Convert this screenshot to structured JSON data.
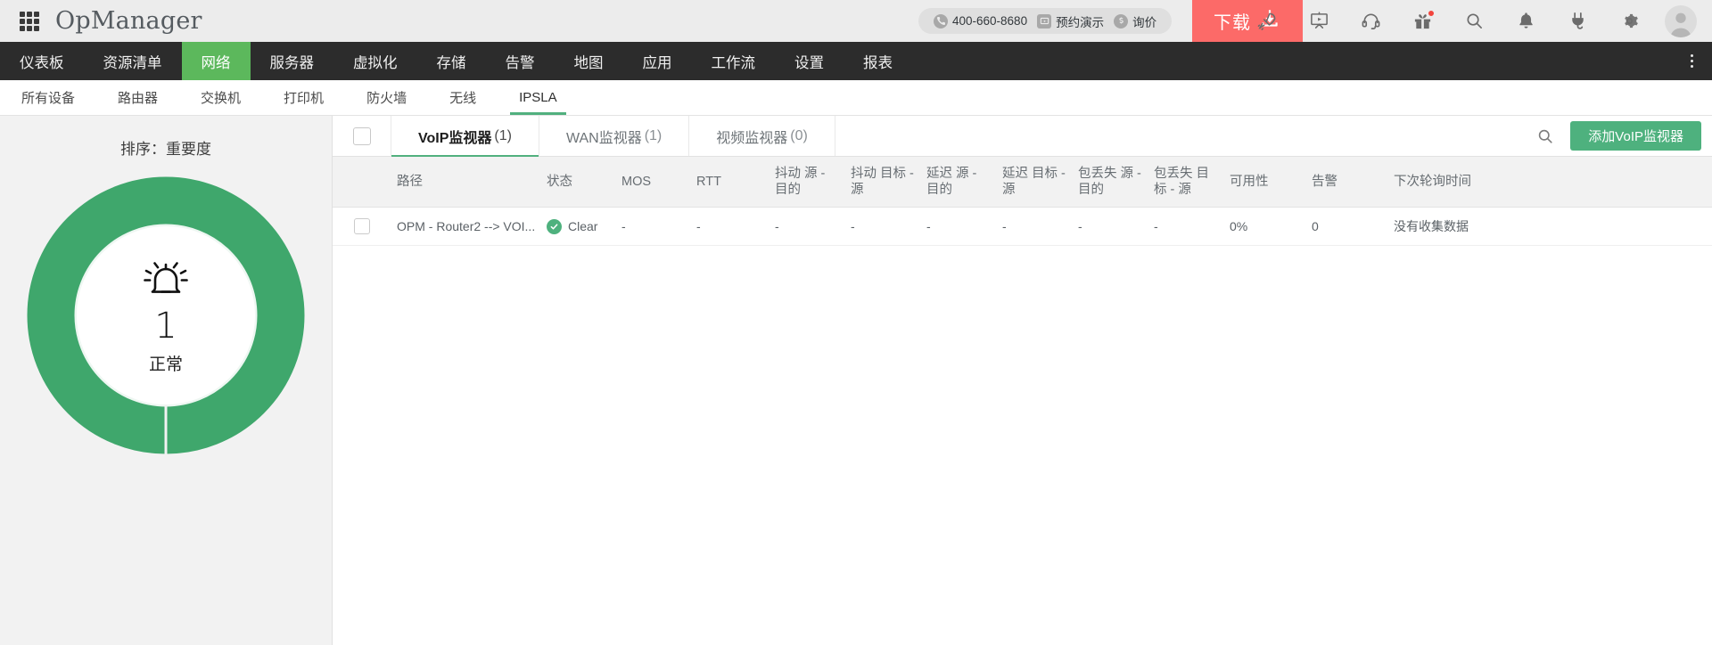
{
  "header": {
    "app_title": "OpManager",
    "grid_icon": "apps-grid-icon",
    "promo": {
      "phone_icon": "phone-icon",
      "phone": "400-660-8680",
      "demo_icon": "video-demo-icon",
      "demo": "预约演示",
      "price_icon": "dollar-icon",
      "price": "询价"
    },
    "download": {
      "label": "下载",
      "icon": "download-icon",
      "color": "#fc6a68"
    },
    "icons": [
      {
        "name": "rocket-icon"
      },
      {
        "name": "presentation-icon"
      },
      {
        "name": "headset-icon"
      },
      {
        "name": "gift-icon",
        "badge": true
      },
      {
        "name": "search-icon"
      },
      {
        "name": "bell-icon"
      },
      {
        "name": "plug-icon"
      },
      {
        "name": "gear-icon"
      },
      {
        "name": "user-avatar-icon"
      }
    ]
  },
  "mainnav": {
    "active_color": "#5cb85c",
    "items": [
      {
        "label": "仪表板",
        "active": false
      },
      {
        "label": "资源清单",
        "active": false
      },
      {
        "label": "网络",
        "active": true
      },
      {
        "label": "服务器",
        "active": false
      },
      {
        "label": "虚拟化",
        "active": false
      },
      {
        "label": "存储",
        "active": false
      },
      {
        "label": "告警",
        "active": false
      },
      {
        "label": "地图",
        "active": false
      },
      {
        "label": "应用",
        "active": false
      },
      {
        "label": "工作流",
        "active": false
      },
      {
        "label": "设置",
        "active": false
      },
      {
        "label": "报表",
        "active": false
      }
    ],
    "overflow_icon": "kebab-menu-icon"
  },
  "subnav": {
    "items": [
      {
        "label": "所有设备",
        "active": false
      },
      {
        "label": "路由器",
        "active": false
      },
      {
        "label": "交换机",
        "active": false
      },
      {
        "label": "打印机",
        "active": false
      },
      {
        "label": "防火墙",
        "active": false
      },
      {
        "label": "无线",
        "active": false
      },
      {
        "label": "IPSLA",
        "active": true
      }
    ],
    "active_color": "#51b07e"
  },
  "sidebar": {
    "sort_label": "排序：重要度",
    "donut": {
      "icon": "alarm-bell-icon",
      "count": "1",
      "caption": "正常",
      "color": "#3fa76c"
    }
  },
  "content": {
    "select_all_checkbox": "select-all-checkbox",
    "tabs": [
      {
        "label": "VoIP监视器",
        "count": "(1)",
        "active": true
      },
      {
        "label": "WAN监视器",
        "count": "(1)",
        "active": false
      },
      {
        "label": "视频监视器",
        "count": "(0)",
        "active": false
      }
    ],
    "search_icon": "search-icon",
    "add_button": {
      "label": "添加VoIP监视器",
      "color": "#4eb17e"
    },
    "table": {
      "columns": [
        "路径",
        "状态",
        "MOS",
        "RTT",
        "抖动 源 - 目的",
        "抖动 目标 - 源",
        "延迟 源 - 目的",
        "延迟 目标 - 源",
        "包丢失 源 - 目的",
        "包丢失 目标 - 源",
        "可用性",
        "告警",
        "下次轮询时间"
      ],
      "rows": [
        {
          "path": "OPM - Router2 --> VOI...",
          "state": "Clear",
          "mos": "-",
          "rtt": "-",
          "jitter_sd": "-",
          "jitter_ds": "-",
          "latency_sd": "-",
          "latency_ds": "-",
          "loss_sd": "-",
          "loss_ds": "-",
          "availability": "0%",
          "alarms": "0",
          "next_poll": "没有收集数据"
        }
      ]
    }
  }
}
